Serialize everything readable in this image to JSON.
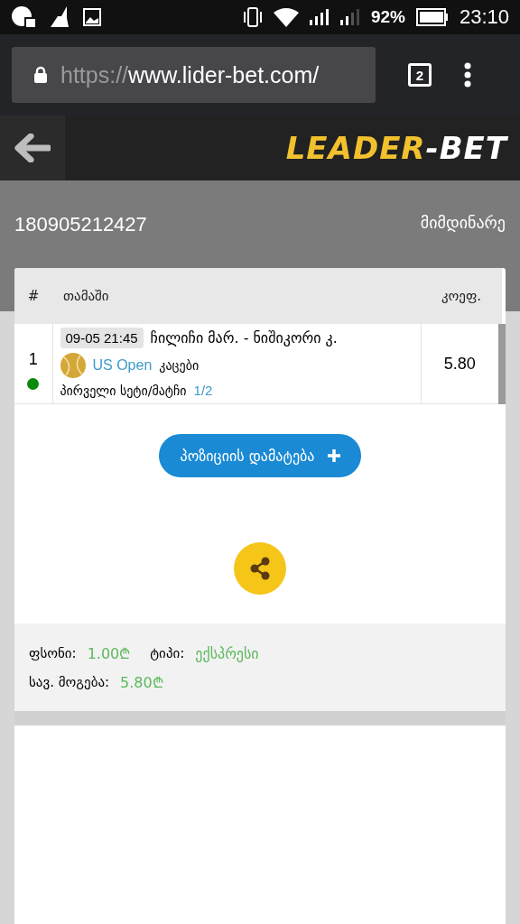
{
  "status_bar": {
    "battery": "92%",
    "time": "23:10"
  },
  "browser": {
    "url_scheme": "https://",
    "url_rest": "www.lider-bet.com/",
    "tab_count": "2"
  },
  "header": {
    "logo_main": "LEADER",
    "logo_tail": "-BET"
  },
  "ticket": {
    "number": "180905212427",
    "state": "მიმდინარე"
  },
  "table": {
    "columns": [
      "#",
      "თამაში",
      "კოეფ."
    ],
    "rows": [
      {
        "index": "1",
        "color": "#0a8a0a",
        "datetime": "09-05 21:45",
        "match": "ჩილიჩი მარ. - ნიშიკორი კ.",
        "tournament": "US Open",
        "category": "კაცები",
        "market": "პირველი სეტი/მატჩი",
        "pick": "1/2",
        "odds": "5.80"
      }
    ]
  },
  "add_button": "პოზიციის დამატება",
  "summary": {
    "stake_label": "ფსონი:",
    "stake": "1.00₾",
    "type_label": "ტიპი:",
    "type": "ექსპრესი",
    "win_label": "სავ. მოგება:",
    "win": "5.80₾"
  }
}
